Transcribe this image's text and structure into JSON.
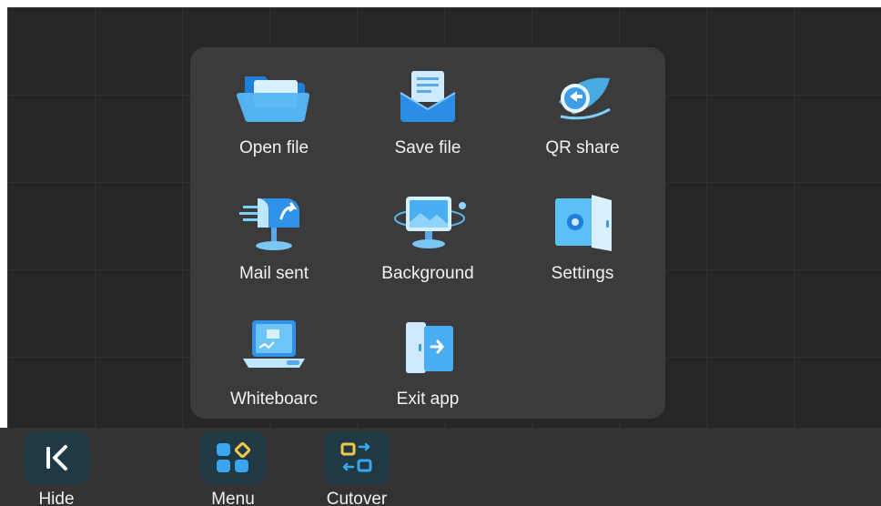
{
  "menu": {
    "items": [
      {
        "label": "Open file",
        "icon": "folder-icon"
      },
      {
        "label": "Save file",
        "icon": "envelope-save-icon"
      },
      {
        "label": "QR share",
        "icon": "share-icon"
      },
      {
        "label": "Mail sent",
        "icon": "mailbox-icon"
      },
      {
        "label": "Background",
        "icon": "monitor-icon"
      },
      {
        "label": "Settings",
        "icon": "settings-door-icon"
      },
      {
        "label": "Whiteboarc",
        "icon": "whiteboard-laptop-icon"
      },
      {
        "label": "Exit app",
        "icon": "exit-door-icon"
      }
    ]
  },
  "taskbar": {
    "hide_label": "Hide",
    "menu_label": "Menu",
    "cutover_label": "Cutover"
  },
  "colors": {
    "canvas": "#262626",
    "panel": "#3b3b3b",
    "taskbar": "#333333",
    "icon_blue": "#3aa6f0",
    "accent_yellow": "#f5c84b"
  }
}
